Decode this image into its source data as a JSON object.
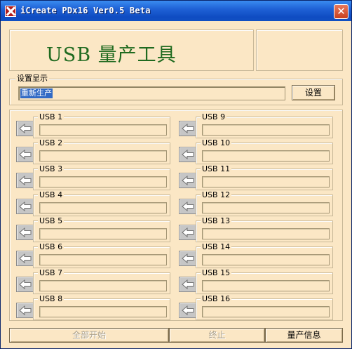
{
  "window": {
    "title": "iCreate PDx16 Ver0.5 Beta",
    "close_glyph": "✕"
  },
  "logo": {
    "text": "USB 量产工具"
  },
  "settings": {
    "group_label": "设置显示",
    "input_value": "重新生产",
    "button_label": "设置"
  },
  "usb_ports": {
    "left": [
      "USB 1",
      "USB 2",
      "USB 3",
      "USB 4",
      "USB 5",
      "USB 6",
      "USB 7",
      "USB 8"
    ],
    "right": [
      "USB 9",
      "USB 10",
      "USB 11",
      "USB 12",
      "USB 13",
      "USB 14",
      "USB 15",
      "USB 16"
    ]
  },
  "actions": {
    "start_all": "全部开始",
    "stop": "终止",
    "production_info": "量产信息"
  },
  "colors": {
    "window_bg": "#fbe7c5",
    "title_bar": "#1f62d6",
    "logo_text": "#1f6a1f",
    "selection": "#316ac5"
  },
  "icons": {
    "app": "app-icon",
    "port_status": "left-arrow-icon"
  }
}
